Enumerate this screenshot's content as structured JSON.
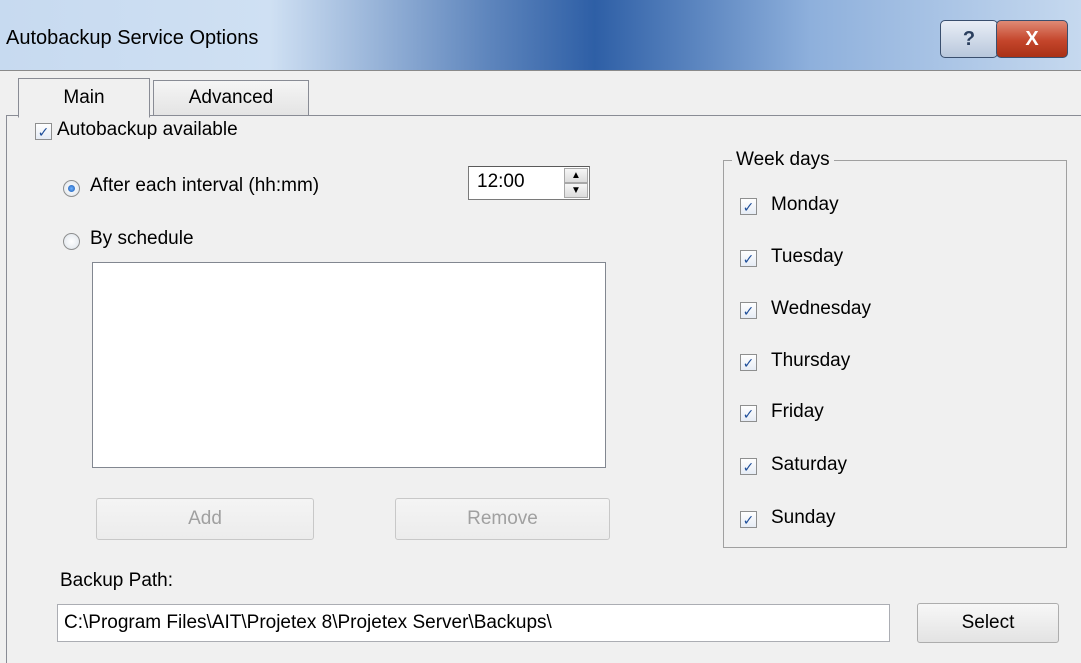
{
  "window": {
    "title": "Autobackup Service Options",
    "help_label": "?",
    "close_label": "X"
  },
  "tabs": [
    {
      "label": "Main"
    },
    {
      "label": "Advanced"
    }
  ],
  "autobackup": {
    "label": "Autobackup available",
    "checked": true
  },
  "interval": {
    "label": "After each interval (hh:mm)",
    "selected": true,
    "value": "12:00"
  },
  "schedule": {
    "label": "By schedule",
    "selected": false,
    "items": []
  },
  "buttons": {
    "add": "Add",
    "remove": "Remove",
    "select": "Select"
  },
  "weekdays": {
    "legend": "Week days",
    "days": [
      {
        "label": "Monday",
        "checked": true
      },
      {
        "label": "Tuesday",
        "checked": true
      },
      {
        "label": "Wednesday",
        "checked": true
      },
      {
        "label": "Thursday",
        "checked": true
      },
      {
        "label": "Friday",
        "checked": true
      },
      {
        "label": "Saturday",
        "checked": true
      },
      {
        "label": "Sunday",
        "checked": true
      }
    ]
  },
  "backup_path": {
    "label": "Backup Path:",
    "value": "C:\\Program Files\\AIT\\Projetex 8\\Projetex Server\\Backups\\"
  },
  "icons": {
    "check": "checkmark-icon",
    "spin_up": "spin-up-icon",
    "spin_down": "spin-down-icon"
  }
}
